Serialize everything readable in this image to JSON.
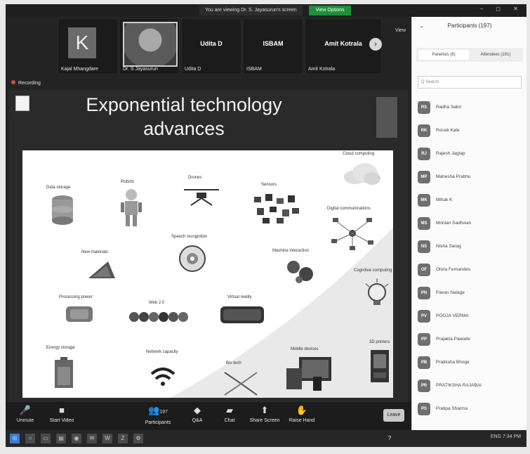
{
  "titlebar": {
    "banner": "You are viewing Dr. S. Jayasurun's screen",
    "view_options": "View Options",
    "controls": "– ◻ ✕"
  },
  "gallery": {
    "tiles": [
      {
        "initial": "K",
        "name": "Kajal Mhangdare"
      },
      {
        "name": "Dr. S Jayasurun"
      },
      {
        "big": "Udita D",
        "name": "Udita D"
      },
      {
        "big": "ISBAM",
        "name": "ISBAM"
      },
      {
        "big": "Amit Kotrala",
        "name": "Amit Kotrala"
      }
    ],
    "next_icon": "›",
    "view_label": "View"
  },
  "recording_label": "Recording",
  "slide": {
    "title_line1": "Exponential technology",
    "title_line2": "advances",
    "items": [
      {
        "label": "Data storage"
      },
      {
        "label": "Robots"
      },
      {
        "label": "Drones"
      },
      {
        "label": "Sensors"
      },
      {
        "label": "Cloud computing"
      },
      {
        "label": "Digital communications"
      },
      {
        "label": "New materials"
      },
      {
        "label": "Speech recognition"
      },
      {
        "label": "Machine interaction"
      },
      {
        "label": "Cognitive computing"
      },
      {
        "label": "Processing power"
      },
      {
        "label": "Web 2.0"
      },
      {
        "label": "Virtual reality"
      },
      {
        "label": "Energy storage"
      },
      {
        "label": "Network capacity"
      },
      {
        "label": "Bio tech"
      },
      {
        "label": "Mobile devices"
      },
      {
        "label": "3D printers"
      }
    ]
  },
  "toolbar": {
    "unmute": "Unmute",
    "start_video": "Start Video",
    "participants": "Participants",
    "participants_count": "197",
    "qa": "Q&A",
    "chat": "Chat",
    "share_screen": "Share Screen",
    "raise_hand": "Raise Hand",
    "leave": "Leave"
  },
  "panel": {
    "title": "Participants (197)",
    "tab_panelists": "Panelists (6)",
    "tab_attendees": "Attendees (191)",
    "search_placeholder": "Q Search",
    "participants": [
      {
        "initials": "RS",
        "name": "Radha Sabri"
      },
      {
        "initials": "RK",
        "name": "Ronak Kale"
      },
      {
        "initials": "RJ",
        "name": "Rajesh Jagtap"
      },
      {
        "initials": "MP",
        "name": "Mahesha Prabhu"
      },
      {
        "initials": "MK",
        "name": "Mihak K"
      },
      {
        "initials": "MS",
        "name": "Mrinlan Sadhwan"
      },
      {
        "initials": "NS",
        "name": "Nisha Sarag"
      },
      {
        "initials": "OF",
        "name": "Olivia Fernandes"
      },
      {
        "initials": "PN",
        "name": "Pavan Nalage"
      },
      {
        "initials": "PV",
        "name": "POOJA VERMA"
      },
      {
        "initials": "PP",
        "name": "Prajakta Pawade"
      },
      {
        "initials": "PB",
        "name": "Pratiksha Bhoge"
      },
      {
        "initials": "PR",
        "name": "PRATIKSHA RAJABAI"
      },
      {
        "initials": "PS",
        "name": "Pratipa Sharma"
      }
    ]
  },
  "taskbar": {
    "tray": "ENG  7:34 PM"
  },
  "colors": {
    "view_options_bg": "#1e8f3a",
    "recording_dot": "#e04545"
  }
}
